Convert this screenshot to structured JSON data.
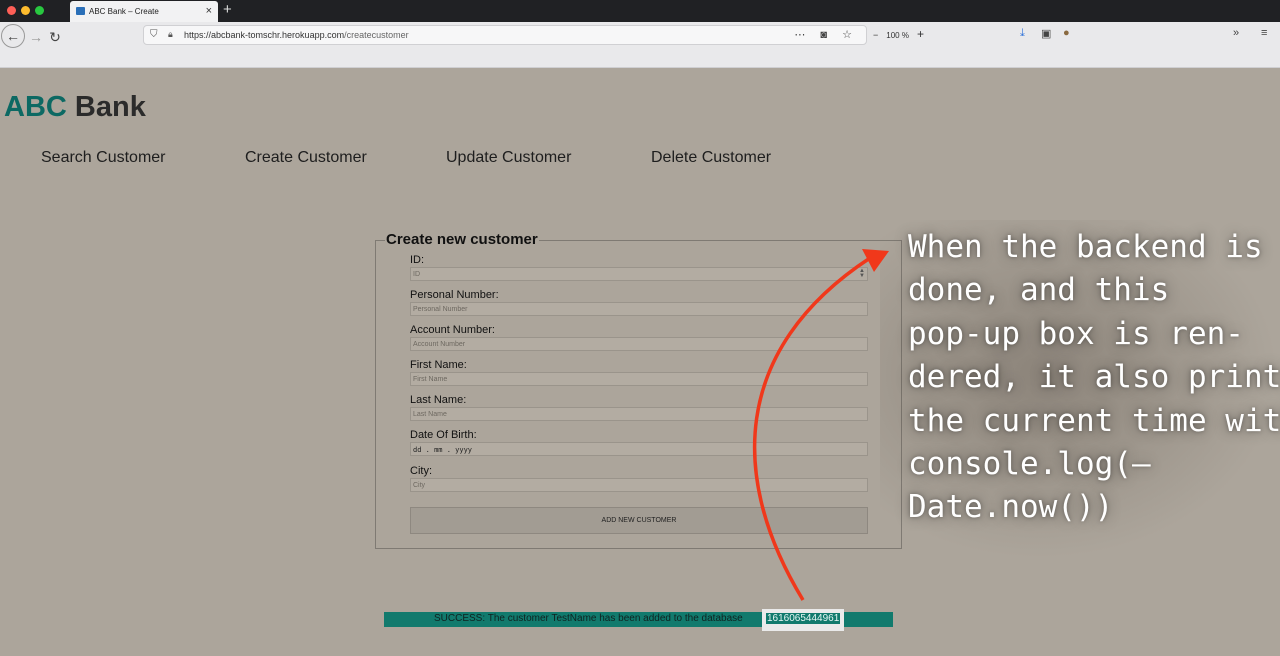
{
  "browser": {
    "tab_title": "ABC Bank – Create",
    "url_host": "https://abcbank-tomschr.herokuapp.com",
    "url_path": "/createcustomer",
    "zoom": "100 %"
  },
  "header": {
    "logo_abc": "ABC",
    "logo_bank": "Bank"
  },
  "nav": [
    {
      "label": "Search Customer"
    },
    {
      "label": "Create Customer"
    },
    {
      "label": "Update Customer"
    },
    {
      "label": "Delete Customer"
    }
  ],
  "form": {
    "legend": "Create new customer",
    "fields": [
      {
        "label": "ID:",
        "placeholder": "ID"
      },
      {
        "label": "Personal Number:",
        "placeholder": "Personal Number"
      },
      {
        "label": "Account Number:",
        "placeholder": "Account Number"
      },
      {
        "label": "First Name:",
        "placeholder": "First Name"
      },
      {
        "label": "Last Name:",
        "placeholder": "Last Name"
      },
      {
        "label": "Date Of Birth:",
        "placeholder": "dd . mm . yyyy"
      },
      {
        "label": "City:",
        "placeholder": "City"
      }
    ],
    "submit_label": "ADD NEW CUSTOMER"
  },
  "banner": {
    "message": "SUCCESS: The customer TestName has been added to the database",
    "timestamp": "1616065444961"
  },
  "annotation": {
    "text": "When the backend is\ndone, and this\npop-up box is ren-\ndered, it also prints\nthe current time with\nconsole.log(–\nDate.now())"
  },
  "colors": {
    "page_bg": "#aca59b",
    "logo_accent": "#0c6963",
    "banner_bg": "#117a6d",
    "arrow": "#f0381b"
  }
}
